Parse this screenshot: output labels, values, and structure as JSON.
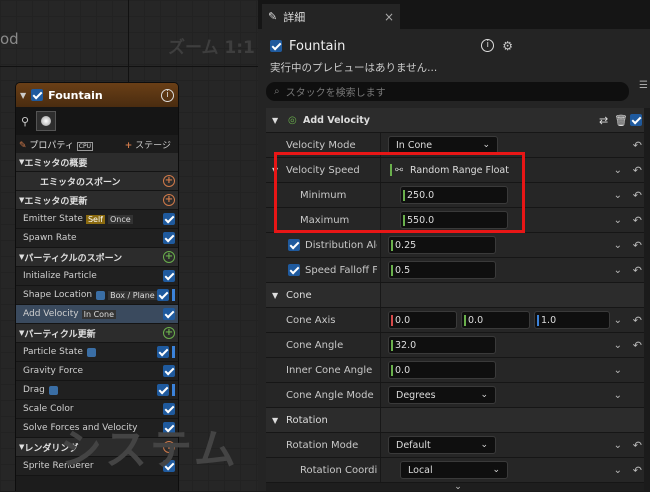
{
  "graph": {
    "partial_title": "od",
    "zoom": "ズーム 1:1",
    "watermark": "システム"
  },
  "node": {
    "title": "Fountain",
    "tab_properties": "プロパティ",
    "tab_properties_icon_label": "CPU",
    "tab_stage": "ステージ",
    "rows": [
      {
        "type": "section",
        "label": "エミッタの概要",
        "right": ""
      },
      {
        "type": "section2",
        "label": "エミッタのスポーン",
        "right": "plus-orange"
      },
      {
        "type": "section",
        "label": "エミッタの更新",
        "right": "plus-orange"
      },
      {
        "type": "item",
        "label": "Emitter State",
        "badge": "Self",
        "badge2": "Once",
        "right": "check"
      },
      {
        "type": "item",
        "label": "Spawn Rate",
        "right": "check"
      },
      {
        "type": "section",
        "label": "パーティクルのスポーン",
        "right": "plus-green"
      },
      {
        "type": "item",
        "label": "Initialize Particle",
        "right": "check"
      },
      {
        "type": "item",
        "label": "Shape Location",
        "box": true,
        "badge2": "Box / Plane",
        "right": "check-bar"
      },
      {
        "type": "item-hl",
        "label": "Add Velocity",
        "badge2": "In Cone",
        "right": "check"
      },
      {
        "type": "section",
        "label": "パーティクル更新",
        "right": "plus-green"
      },
      {
        "type": "item",
        "label": "Particle State",
        "box": true,
        "right": "check-bar"
      },
      {
        "type": "item",
        "label": "Gravity Force",
        "right": "check"
      },
      {
        "type": "item",
        "label": "Drag",
        "box": true,
        "right": "check-bar"
      },
      {
        "type": "item",
        "label": "Scale Color",
        "right": "check"
      },
      {
        "type": "item",
        "label": "Solve Forces and Velocity",
        "right": "check"
      },
      {
        "type": "section",
        "label": "レンダリング",
        "right": "plus-orange"
      },
      {
        "type": "item",
        "label": "Sprite Renderer",
        "right": "check"
      }
    ]
  },
  "details": {
    "tab_title": "詳細",
    "emitter_name": "Fountain",
    "preview_note": "実行中のプレビューはありません...",
    "search_placeholder": "スタックを検索します",
    "add_velocity": {
      "header": "Add Velocity",
      "velocity_mode_label": "Velocity Mode",
      "velocity_mode_value": "In Cone",
      "velocity_speed_label": "Velocity Speed",
      "velocity_speed_value": "Random Range Float",
      "minimum_label": "Minimum",
      "minimum_value": "250.0",
      "maximum_label": "Maximum",
      "maximum_value": "550.0",
      "distribution_label": "Distribution Alor",
      "distribution_value": "0.25",
      "speed_falloff_label": "Speed Falloff Fr",
      "speed_falloff_value": "0.5"
    },
    "cone": {
      "header": "Cone",
      "cone_axis_label": "Cone Axis",
      "cone_axis_x": "0.0",
      "cone_axis_y": "0.0",
      "cone_axis_z": "1.0",
      "cone_angle_label": "Cone Angle",
      "cone_angle_value": "32.0",
      "inner_cone_angle_label": "Inner Cone Angle",
      "inner_cone_angle_value": "0.0",
      "cone_angle_mode_label": "Cone Angle Mode",
      "cone_angle_mode_value": "Degrees"
    },
    "rotation": {
      "header": "Rotation",
      "rotation_mode_label": "Rotation Mode",
      "rotation_mode_value": "Default",
      "rotation_coord_label": "Rotation Coordina",
      "rotation_coord_value": "Local"
    }
  },
  "colors": {
    "highlight_box": "#e81616",
    "checkbox": "#1f5a9e",
    "node_header": "#6a3f16",
    "x_axis": "#d64a4a",
    "y_axis": "#6ab04c",
    "z_axis": "#3b82d9"
  }
}
